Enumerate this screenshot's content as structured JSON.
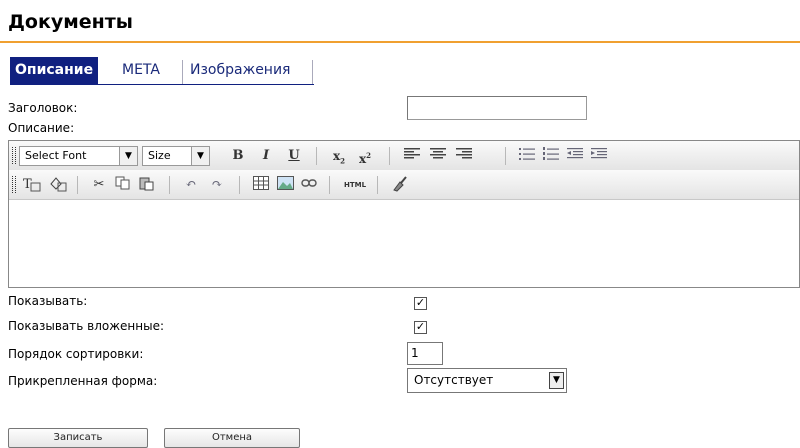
{
  "page": {
    "title": "Документы"
  },
  "tabs": [
    {
      "label": "Описание",
      "active": true
    },
    {
      "label": "META",
      "active": false
    },
    {
      "label": "Изображения",
      "active": false
    }
  ],
  "form": {
    "title_label": "Заголовок:",
    "title_value": "",
    "description_label": "Описание:",
    "show_label": "Показывать:",
    "show_checked": true,
    "show_nested_label": "Показывать вложенные:",
    "show_nested_checked": true,
    "sort_label": "Порядок сортировки:",
    "sort_value": "1",
    "form_label": "Прикрепленная форма:",
    "form_value": "Отсутствует"
  },
  "editor": {
    "font_select": "Select Font",
    "size_select": "Size",
    "html_label": "HTML",
    "bold": "B",
    "italic": "I",
    "underline": "U"
  },
  "buttons": {
    "save": "Записать",
    "cancel": "Отмена"
  },
  "colors": {
    "accent": "#f0a030",
    "tab_active": "#102080",
    "tab_text": "#1a2a7a"
  }
}
